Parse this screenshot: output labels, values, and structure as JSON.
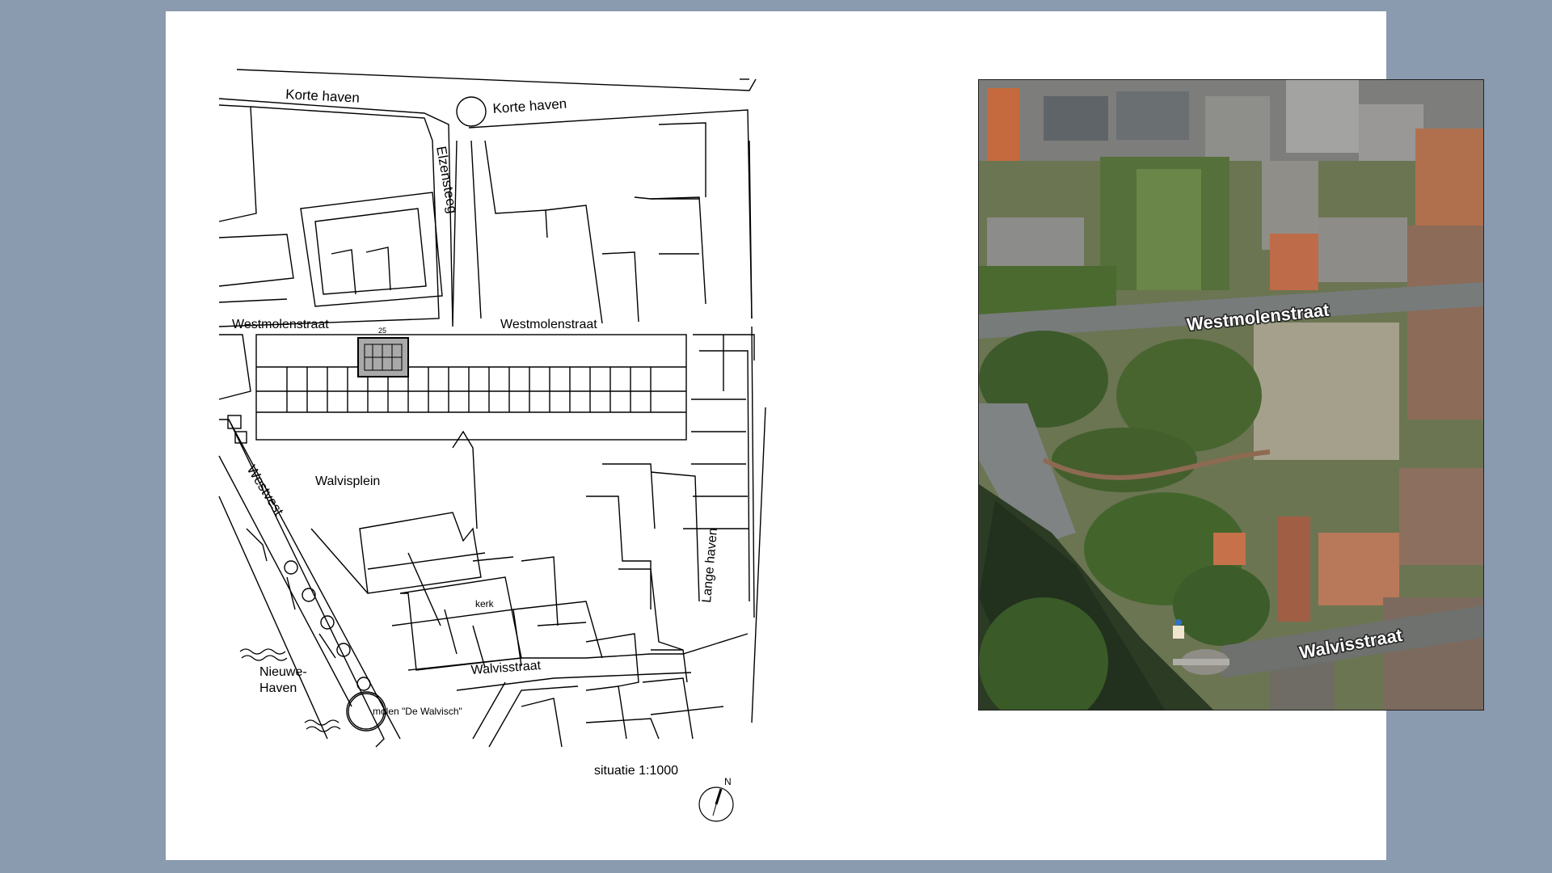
{
  "map": {
    "labels": {
      "korte_haven_left": "Korte haven",
      "korte_haven_right": "Korte haven",
      "elzensteeg": "Elzensteeg",
      "westmolenstraat_left": "Westmolenstraat",
      "westmolenstraat_right": "Westmolenstraat",
      "house_number": "25",
      "walvisplein": "Walvisplein",
      "westvest": "Westvest",
      "kerk": "kerk",
      "lange_haven": "Lange haven",
      "walvisstraat": "Walvisstraat",
      "nieuwe_haven_line1": "Nieuwe-",
      "nieuwe_haven_line2": "Haven",
      "molen": "molen \"De Walvisch\""
    },
    "scale_text": "situatie 1:1000",
    "north_label": "N"
  },
  "aerial": {
    "labels": {
      "westmolenstraat": "Westmolenstraat",
      "walvisstraat": "Walvisstraat"
    }
  }
}
